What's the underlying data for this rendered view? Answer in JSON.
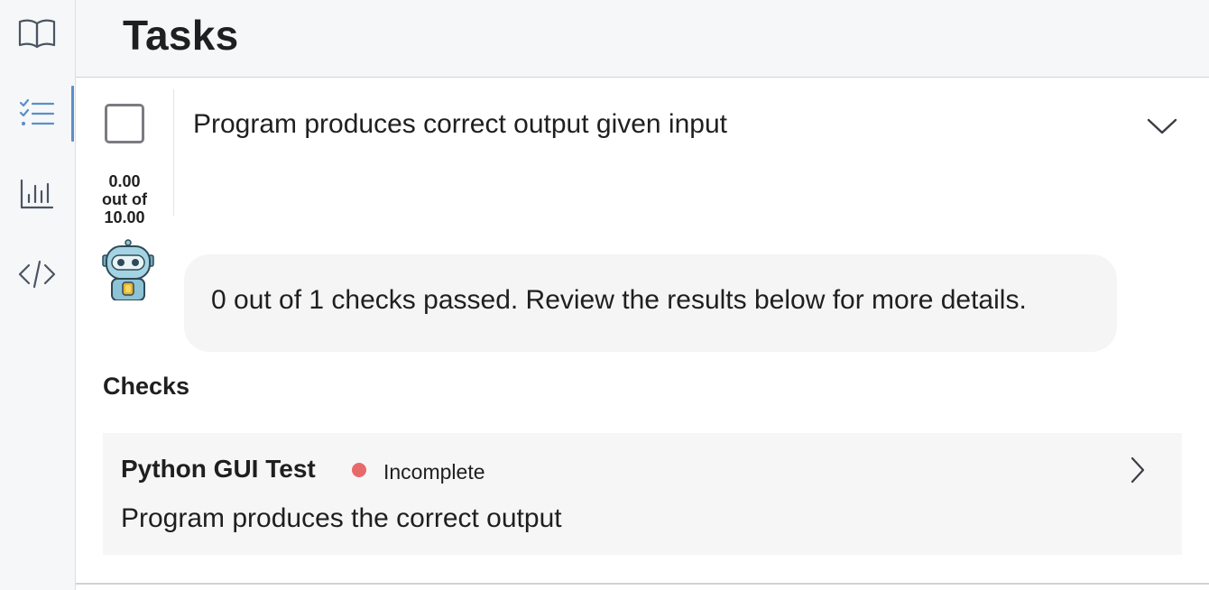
{
  "header": {
    "title": "Tasks"
  },
  "rail": {
    "items": [
      {
        "icon": "book-icon",
        "active": false
      },
      {
        "icon": "checklist-icon",
        "active": true
      },
      {
        "icon": "bar-chart-icon",
        "active": false
      },
      {
        "icon": "code-icon",
        "active": false
      }
    ],
    "accent_color": "#5a8fcb"
  },
  "task": {
    "title": "Program produces correct output given input",
    "score": {
      "earned": "0.00",
      "out_of_label": "out of",
      "possible": "10.00"
    },
    "expand_icon": "chevron-down-icon"
  },
  "feedback": {
    "avatar": "robot-icon",
    "message": "0 out of 1 checks passed. Review the results below for more details."
  },
  "checks": {
    "heading": "Checks",
    "items": [
      {
        "name": "Python GUI Test",
        "status": "Incomplete",
        "status_color": "#e8696a",
        "description": "Program produces the correct output",
        "icon": "chevron-right-icon"
      }
    ]
  }
}
